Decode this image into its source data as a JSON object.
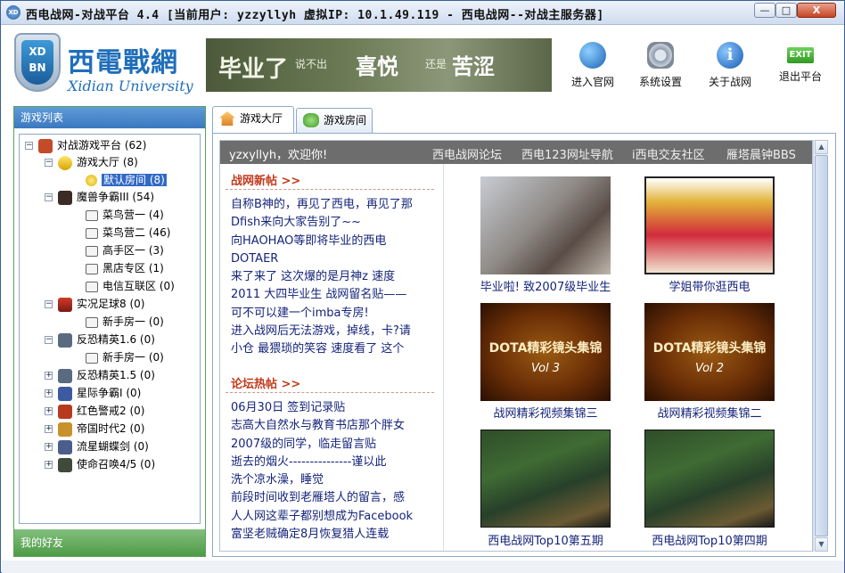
{
  "window": {
    "title": "西电战网-对战平台 4.4 [当前用户: yzzyllyh 虚拟IP: 10.1.49.119 - 西电战网--对战主服务器]",
    "app_icon_text": "XD"
  },
  "window_controls": {
    "minimize": "—",
    "maximize": "□",
    "close": "X"
  },
  "logo": {
    "shield": "XD BN",
    "cn_name": "西電戰網",
    "en_name": "Xidian University"
  },
  "banner": {
    "t1": "毕业了",
    "t2": "说不出",
    "t3": "喜悦",
    "t4": "还是",
    "t5": "苦涩"
  },
  "header_buttons": [
    {
      "label": "进入官网",
      "icon": "globe-icon"
    },
    {
      "label": "系统设置",
      "icon": "gear-icon"
    },
    {
      "label": "关于战网",
      "icon": "info-icon",
      "glyph": "i"
    },
    {
      "label": "退出平台",
      "icon": "exit-icon",
      "glyph": "EXIT"
    }
  ],
  "left_panel": {
    "title": "游戏列表",
    "footer": "我的好友",
    "tree": [
      {
        "label": "对战游戏平台 (62)",
        "expander": "−",
        "icon": "platform-icon"
      },
      {
        "label": "游戏大厅 (8)",
        "expander": "−",
        "icon": "star-icon"
      },
      {
        "label": "默认房间 (8)",
        "expander": "",
        "icon": "smiley-icon"
      },
      {
        "label": "魔兽争霸III (54)",
        "expander": "−",
        "icon": "warcraft-icon"
      },
      {
        "label": "菜鸟营一 (4)",
        "expander": "",
        "icon": "room-icon"
      },
      {
        "label": "菜鸟营二 (46)",
        "expander": "",
        "icon": "room-icon"
      },
      {
        "label": "高手区一 (3)",
        "expander": "",
        "icon": "room-icon"
      },
      {
        "label": "黑店专区 (1)",
        "expander": "",
        "icon": "room-icon"
      },
      {
        "label": "电信互联区 (0)",
        "expander": "",
        "icon": "room-icon"
      },
      {
        "label": "实况足球8 (0)",
        "expander": "−",
        "icon": "soccer-icon"
      },
      {
        "label": "新手房一 (0)",
        "expander": "",
        "icon": "room-icon"
      },
      {
        "label": "反恐精英1.6 (0)",
        "expander": "−",
        "icon": "cs-icon"
      },
      {
        "label": "新手房一 (0)",
        "expander": "",
        "icon": "room-icon"
      },
      {
        "label": "反恐精英1.5 (0)",
        "expander": "+",
        "icon": "cs-icon"
      },
      {
        "label": "星际争霸I (0)",
        "expander": "+",
        "icon": "starcraft-icon"
      },
      {
        "label": "红色警戒2 (0)",
        "expander": "+",
        "icon": "redalert-icon"
      },
      {
        "label": "帝国时代2 (0)",
        "expander": "+",
        "icon": "aoe-icon"
      },
      {
        "label": "流星蝴蝶剑 (0)",
        "expander": "+",
        "icon": "meteor-icon"
      },
      {
        "label": "使命召唤4/5 (0)",
        "expander": "+",
        "icon": "cod-icon"
      }
    ]
  },
  "tabs": [
    {
      "label": "游戏大厅",
      "icon": "home-icon"
    },
    {
      "label": "游戏房间",
      "icon": "gamepad-icon"
    }
  ],
  "portal": {
    "welcome": "yzxyllyh，欢迎你!",
    "links": [
      "西电战网论坛",
      "西电123网址导航",
      "i西电交友社区",
      "雁塔晨钟BBS"
    ],
    "section1_title": "战网新帖  >>",
    "section1_items": [
      "自称B神的，再见了西电，再见了那",
      "Dfish来向大家告别了~~",
      "向HAOHAO等即将毕业的西电",
      "DOTAER",
      "来了来了 这次爆的是月神z 速度",
      "2011 大四毕业生 战网留名贴——",
      "可不可以建一个imba专房!",
      "进入战网后无法游戏，掉线，卡?请",
      "小仓 最猥琐的笑容 速度看了 这个"
    ],
    "section2_title": "论坛热帖  >>",
    "section2_items": [
      "06月30日  签到记录贴",
      "志高大自然水与教育书店那个胖女",
      "2007级的同学，临走留言贴",
      "逝去的烟火---------------谨以此",
      "洗个凉水澡，睡觉",
      "前段时间收到老雁塔人的留言，感",
      "人人网这辈子都别想成为Facebook",
      "富坚老贼确定8月恢复猎人连载"
    ],
    "videos": [
      {
        "caption": "毕业啦! 致2007级毕业生",
        "style": "photo1"
      },
      {
        "caption": "学姐带你逛西电",
        "style": "photo2"
      },
      {
        "caption": "战网精彩视频集锦三",
        "style": "dota",
        "overlay": "DOTA精彩镜头集锦",
        "vol": "Vol 3"
      },
      {
        "caption": "战网精彩视频集锦二",
        "style": "dota",
        "overlay": "DOTA精彩镜头集锦",
        "vol": "Vol 2"
      },
      {
        "caption": "西电战网Top10第五期",
        "style": "game"
      },
      {
        "caption": "西电战网Top10第四期",
        "style": "game"
      }
    ]
  },
  "colors": {
    "tree_selection": "#3169c6",
    "panel_header": "#3b78bf",
    "friends_bar": "#4e9b47",
    "section_title": "#c23a1a",
    "link_text": "#15247a"
  }
}
